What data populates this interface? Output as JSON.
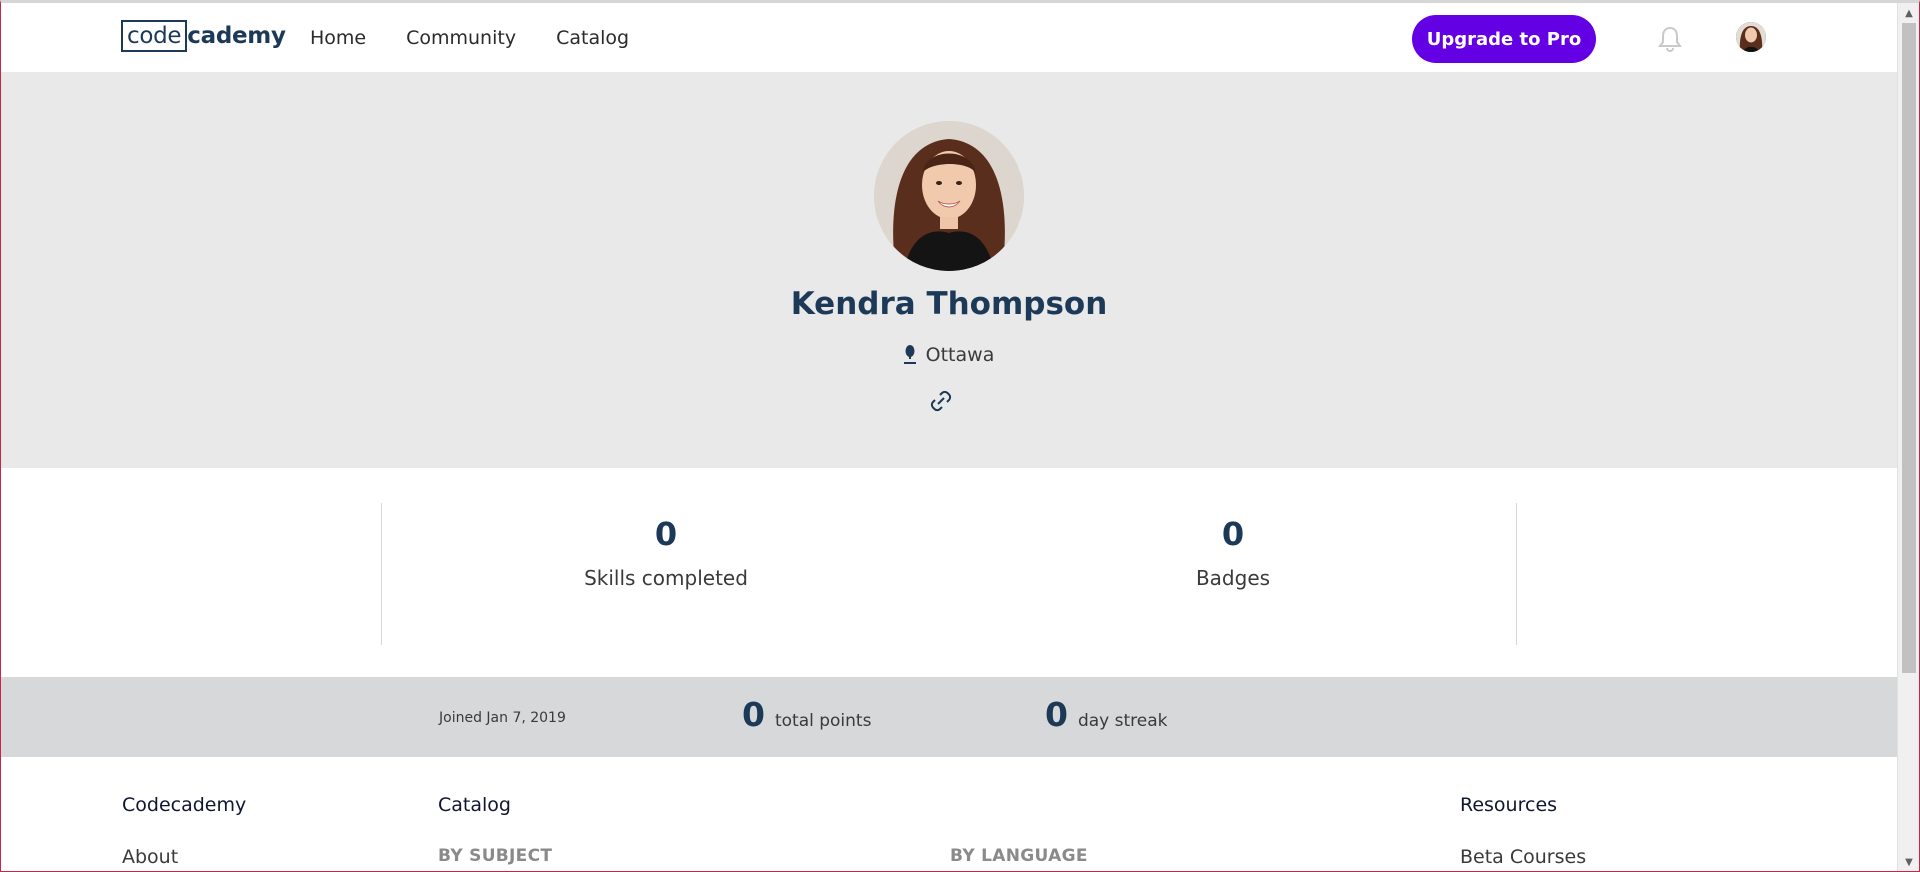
{
  "header": {
    "logo_code": "code",
    "logo_rest": "cademy",
    "nav": [
      "Home",
      "Community",
      "Catalog"
    ],
    "upgrade_label": "Upgrade to Pro",
    "brand_color": "#6400e4"
  },
  "profile": {
    "name": "Kendra Thompson",
    "location": "Ottawa",
    "icons": {
      "location": "map-pin-icon",
      "link": "link-icon"
    }
  },
  "stats": {
    "skills": {
      "value": "0",
      "label": "Skills completed"
    },
    "badges": {
      "value": "0",
      "label": "Badges"
    }
  },
  "meta": {
    "joined": "Joined Jan 7, 2019",
    "points": {
      "value": "0",
      "label": "total points"
    },
    "streak": {
      "value": "0",
      "label": "day streak"
    }
  },
  "footer": {
    "codecademy": {
      "title": "Codecademy",
      "first_link": "About"
    },
    "catalog": {
      "title": "Catalog",
      "by_subject": "BY SUBJECT",
      "by_language": "BY LANGUAGE"
    },
    "resources": {
      "title": "Resources",
      "first_link": "Beta Courses"
    }
  }
}
